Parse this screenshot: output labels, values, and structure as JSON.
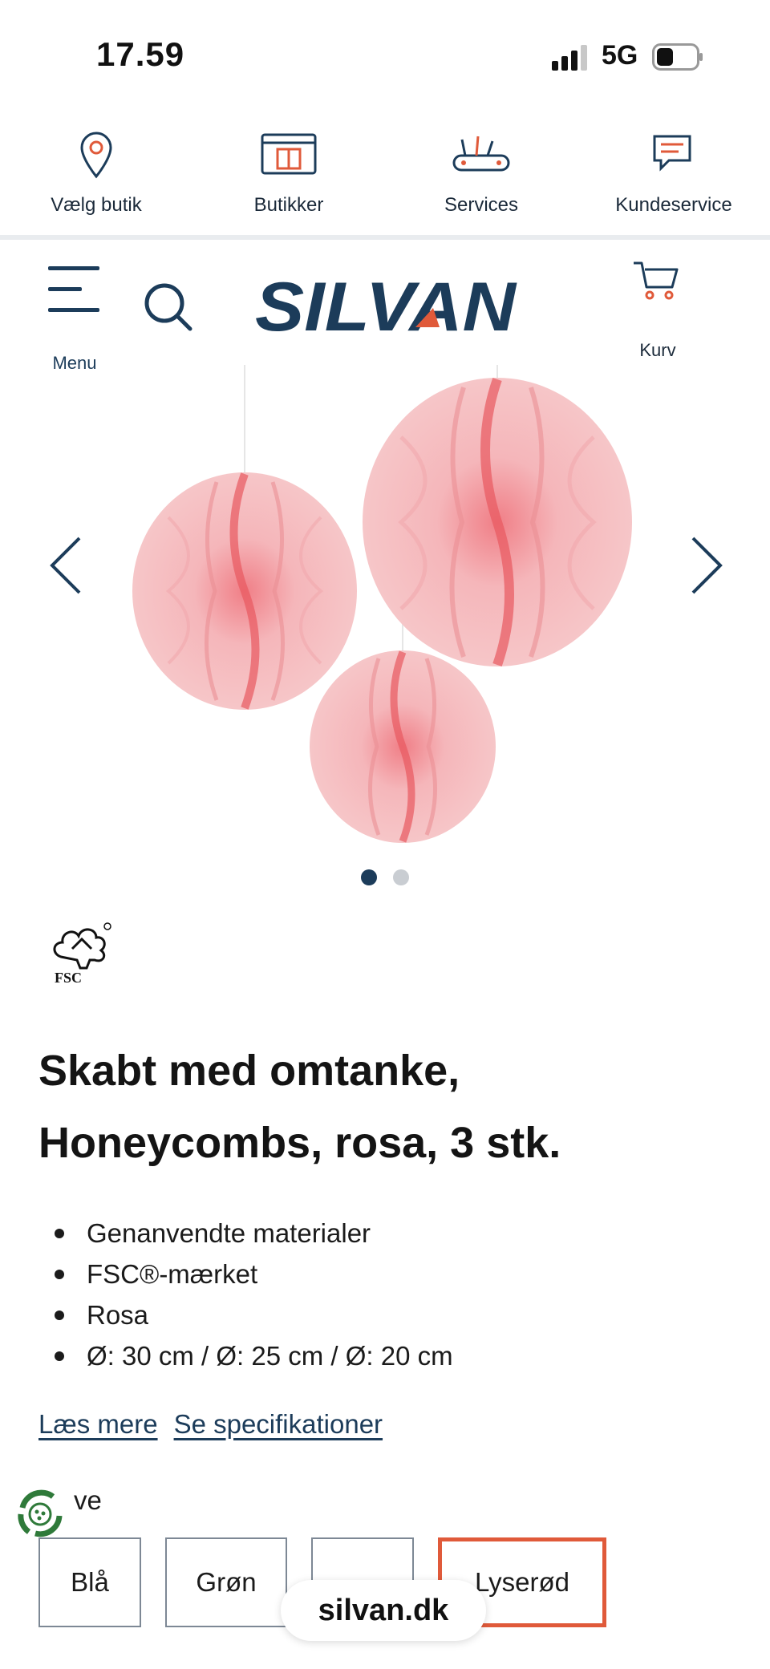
{
  "status_bar": {
    "time": "17.59",
    "network": "5G"
  },
  "top_nav": [
    {
      "label": "Vælg butik",
      "icon": "location-pin-icon"
    },
    {
      "label": "Butikker",
      "icon": "store-icon"
    },
    {
      "label": "Services",
      "icon": "tools-icon"
    },
    {
      "label": "Kundeservice",
      "icon": "chat-icon"
    }
  ],
  "header": {
    "menu_label": "Menu",
    "logo_text": "SILVAN",
    "cart_label": "Kurv"
  },
  "carousel": {
    "slide_count": 2,
    "active_index": 0
  },
  "product": {
    "fsc_label": "FSC",
    "title_line1": "Skabt med omtanke,",
    "title_line2": "Honeycombs, rosa, 3 stk.",
    "features": [
      "Genanvendte materialer",
      "FSC®-mærket",
      "Rosa",
      "Ø: 30 cm / Ø: 25 cm / Ø: 20 cm"
    ],
    "read_more": "Læs mere",
    "specs_link": "Se specifikationer",
    "color_label": "ve",
    "colors": [
      "Blå",
      "Grøn",
      "",
      "Lyserød"
    ],
    "selected_color": "Lyserød"
  },
  "browser": {
    "url": "silvan.dk"
  },
  "colors": {
    "brand_navy": "#1c3c5a",
    "accent_orange": "#e05a3a",
    "honeycomb_pink": "#f2b8bb"
  }
}
